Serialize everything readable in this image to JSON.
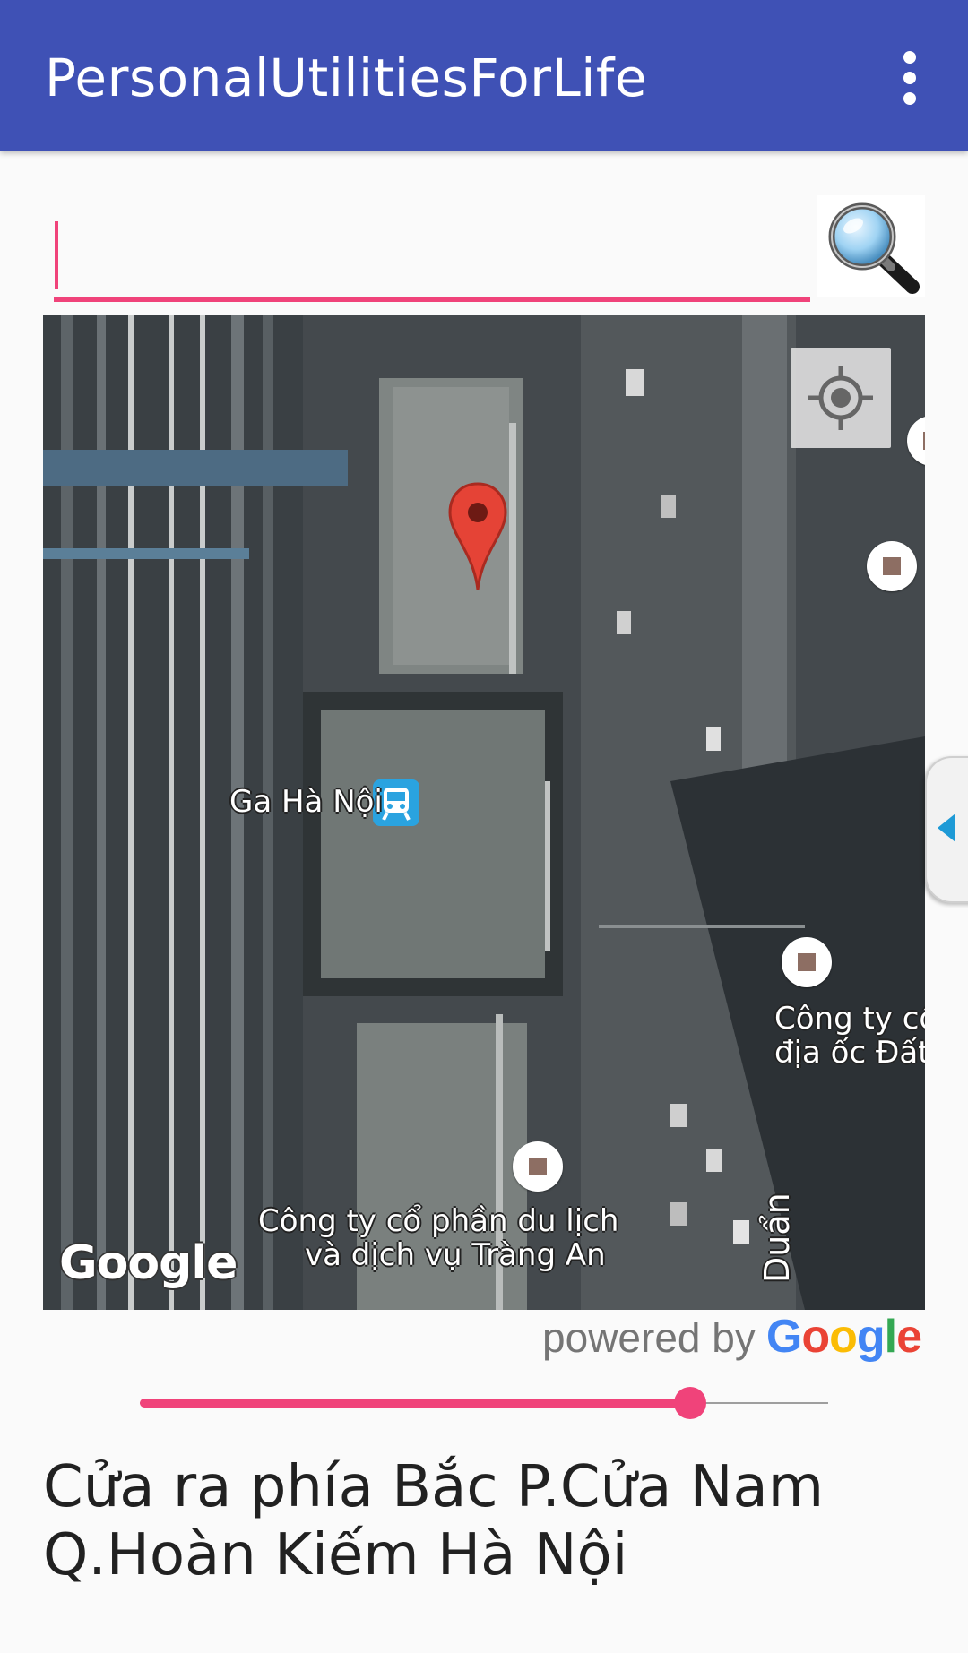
{
  "app_bar": {
    "title": "PersonalUtilitiesForLife",
    "overflow_icon": "more-vert-icon",
    "background": "#3f51b5"
  },
  "search": {
    "value": "",
    "placeholder": "",
    "button_icon": "magnifier-icon",
    "accent": "#f0437a"
  },
  "map": {
    "type": "satellite",
    "locate_icon": "my-location-icon",
    "marker_icon": "red-map-pin-icon",
    "attribution": "Google",
    "labels": {
      "station": "Ga Hà Nội",
      "company_1_line1": "Công ty cổ",
      "company_1_line2": "địa ốc Đất V",
      "company_2_line1": "Công ty cổ phần du lịch",
      "company_2_line2": "và dịch vụ Tràng An",
      "street": "Duẩn"
    },
    "station_icon": "train-icon",
    "poi_icon": "poi-square-icon"
  },
  "powered_by": {
    "text": "powered by",
    "logo": "Google"
  },
  "slider": {
    "value": 0.8
  },
  "address": {
    "line1": "Cửa ra phía Bắc P.Cửa Nam",
    "line2": "Q.Hoàn Kiếm Hà Nội"
  },
  "drawer_handle_icon": "chevron-left-icon"
}
